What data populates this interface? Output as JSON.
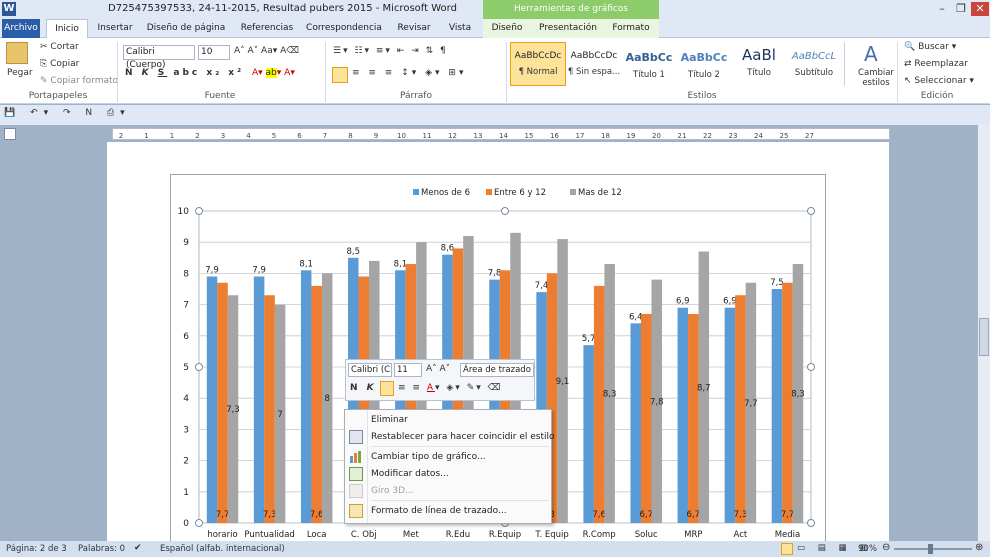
{
  "titlebar": {
    "title": "D725475397533, 24-11-2015, Resultad pubers  2015  -  Microsoft Word",
    "context_header": "Herramientas de gráficos",
    "minimize": "–",
    "restore": "❐",
    "close": "✕"
  },
  "tabs": [
    "Archivo",
    "Inicio",
    "Insertar",
    "Diseño de página",
    "Referencias",
    "Correspondencia",
    "Revisar",
    "Vista",
    "Diseño",
    "Presentación",
    "Formato"
  ],
  "ribbon": {
    "clipboard": {
      "paste": "Pegar",
      "cut": "Cortar",
      "copy": "Copiar",
      "format_painter": "Copiar formato",
      "label": "Portapapeles"
    },
    "font": {
      "name": "Calibri (Cuerpo)",
      "size": "10",
      "label": "Fuente"
    },
    "paragraph": {
      "label": "Párrafo"
    },
    "styles": {
      "items": [
        {
          "sample": "AaBbCcDc",
          "name": "¶ Normal"
        },
        {
          "sample": "AaBbCcDc",
          "name": "¶ Sin espa..."
        },
        {
          "sample": "AaBbCc",
          "name": "Título 1"
        },
        {
          "sample": "AaBbCc",
          "name": "Título 2"
        },
        {
          "sample": "AaBl",
          "name": "Título"
        },
        {
          "sample": "AaBbCcL",
          "name": "Subtítulo"
        }
      ],
      "change": "Cambiar estilos",
      "label": "Estilos"
    },
    "editing": {
      "find": "Buscar",
      "replace": "Reemplazar",
      "select": "Seleccionar",
      "label": "Edición"
    }
  },
  "statusbar": {
    "page": "Página: 2 de 3",
    "words": "Palabras: 0",
    "language": "Español (alfab. internacional)",
    "zoom": "90%"
  },
  "ruler_ticks": [
    "2",
    "1",
    "1",
    "2",
    "3",
    "4",
    "5",
    "6",
    "7",
    "8",
    "9",
    "10",
    "11",
    "12",
    "13",
    "14",
    "15",
    "16",
    "17",
    "18",
    "19",
    "20",
    "21",
    "22",
    "23",
    "24",
    "25",
    "27"
  ],
  "minitoolbar": {
    "font": "Calibri (C",
    "size": "11",
    "target": "Área de trazado"
  },
  "context_menu": [
    {
      "label": "Eliminar",
      "enabled": true
    },
    {
      "label": "Restablecer para hacer coincidir el estilo",
      "enabled": true
    },
    {
      "label": "Cambiar tipo de gráfico...",
      "enabled": true
    },
    {
      "label": "Modificar datos...",
      "enabled": true
    },
    {
      "label": "Giro 3D...",
      "enabled": false
    },
    {
      "label": "Formato de línea de trazado...",
      "enabled": true
    }
  ],
  "colors": {
    "series1": "#5b9bd5",
    "series2": "#ed7d31",
    "series3": "#a5a5a5",
    "file_tab": "#2a5ea8",
    "context_tab": "#8ccc6a"
  },
  "chart_data": {
    "type": "bar",
    "categories": [
      "horario",
      "Puntualidad",
      "Loca",
      "C. Obj",
      "Met",
      "R.Edu",
      "R.Equip",
      "T. Equip",
      "R.Comp",
      "Soluc",
      "MRP",
      "Act",
      "Media"
    ],
    "series": [
      {
        "name": "Menos de 6",
        "values": [
          7.9,
          7.9,
          8.1,
          8.5,
          8.1,
          8.6,
          7.8,
          7.4,
          5.7,
          6.4,
          6.9,
          6.9,
          7.5
        ],
        "labels": [
          "7,9",
          "7,9",
          "8,1",
          "8,5",
          "8,1",
          "8,6",
          "7,8",
          "7,4",
          "5,7",
          "6,4",
          "6,9",
          "6,9",
          "7,5"
        ]
      },
      {
        "name": "Entre 6 y 12",
        "values": [
          7.7,
          7.3,
          7.6,
          7.9,
          8.3,
          8.8,
          8.1,
          8.0,
          7.6,
          6.7,
          6.7,
          7.3,
          7.7
        ],
        "labels": [
          "7,7",
          "7,3",
          "7,6",
          "",
          "",
          "",
          "",
          "8",
          "7,6",
          "6,7",
          "6,7",
          "7,3",
          "7,7"
        ]
      },
      {
        "name": "Mas de 12",
        "values": [
          7.3,
          7.0,
          8.0,
          8.4,
          9.0,
          9.2,
          9.3,
          9.1,
          8.3,
          7.8,
          8.7,
          7.7,
          8.3
        ],
        "labels": [
          "7,3",
          "7",
          "8",
          "",
          "",
          "",
          "",
          "9,1",
          "8,3",
          "7,8",
          "8,7",
          "7,7",
          "8,3"
        ]
      }
    ],
    "ylim": [
      0,
      10
    ],
    "yticks": [
      "0",
      "1",
      "2",
      "3",
      "4",
      "5",
      "6",
      "7",
      "8",
      "9",
      "10"
    ],
    "legend": "top",
    "grid": true
  }
}
